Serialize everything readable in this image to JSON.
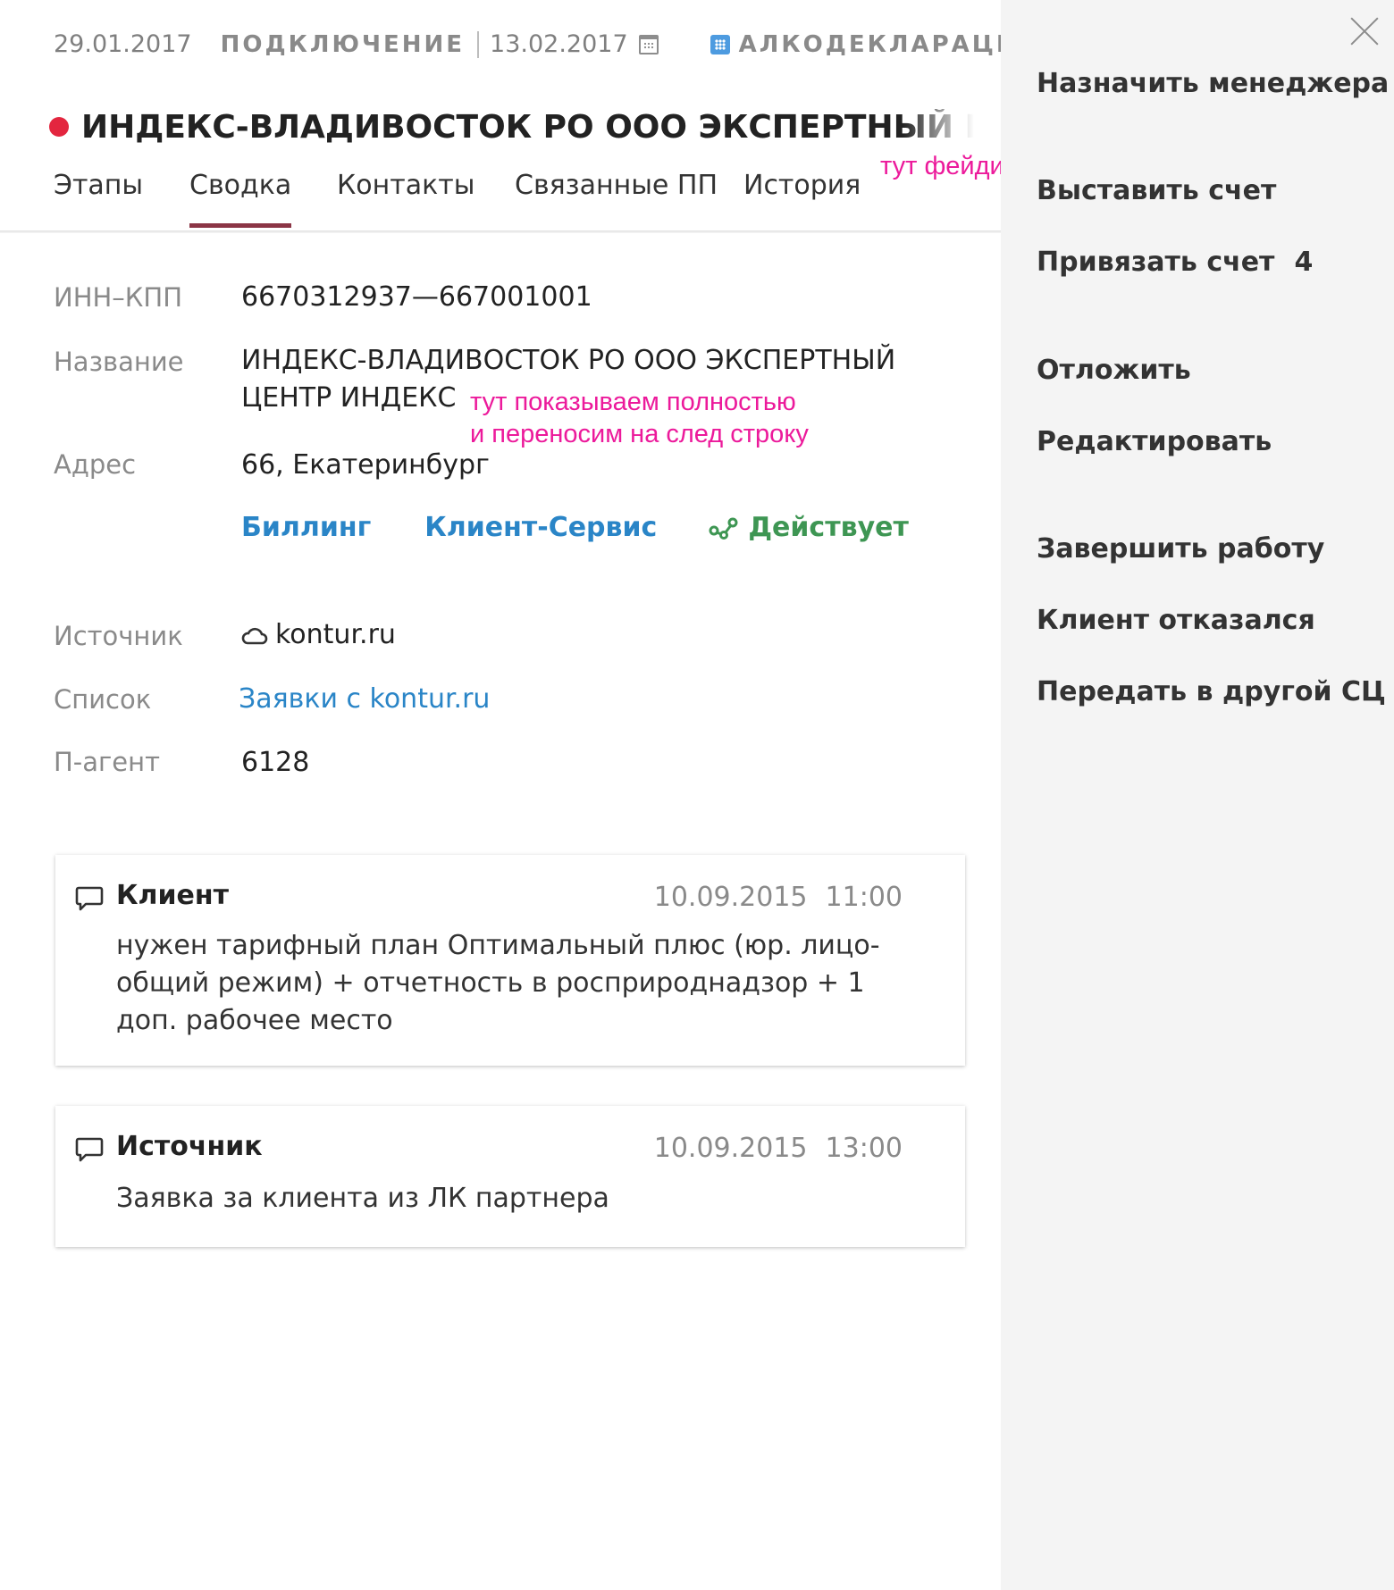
{
  "header": {
    "date_start": "29.01.2017",
    "stage": "ПОДКЛЮЧЕНИЕ",
    "date_due": "13.02.2017",
    "product": "АЛКОДЕКЛАРАЦИЯ",
    "title": "ИНДЕКС-ВЛАДИВОСТОК РО ООО ЭКСПЕРТНЫЙ ЦЕНТР ИНДЕКС",
    "status_color": "#e3263f",
    "fade_note": "тут фейдим"
  },
  "tabs": [
    {
      "label": "Этапы",
      "active": false
    },
    {
      "label": "Сводка",
      "active": true
    },
    {
      "label": "Контакты",
      "active": false
    },
    {
      "label": "Связанные ПП",
      "active": false
    },
    {
      "label": "История",
      "active": false
    }
  ],
  "fields": {
    "inn_label": "ИНН–КПП",
    "inn_value": "6670312937—667001001",
    "name_label": "Название",
    "name_value": "ИНДЕКС-ВЛАДИВОСТОК РО ООО ЭКСПЕРТНЫЙ ЦЕНТР ИНДЕКС",
    "name_note": "тут показываем полностью\nи переносим на след строку",
    "address_label": "Адрес",
    "address_value": "66, Екатеринбург",
    "source_label": "Источник",
    "source_value": "kontur.ru",
    "source_icon": "cloud-icon",
    "list_label": "Список",
    "list_value": "Заявки с kontur.ru",
    "agent_label": "П-агент",
    "agent_value": "6128"
  },
  "links": {
    "billing": "Биллинг",
    "client_service": "Клиент-Сервис",
    "status": "Действует",
    "status_color": "#3e9653",
    "link_color": "#2a85c7"
  },
  "comments": [
    {
      "author": "Клиент",
      "date": "10.09.2015",
      "time": "11:00",
      "text": "нужен тарифный план Оптимальный плюс (юр. лицо-общий режим) + отчетность в росприроднадзор + 1 доп. рабочее место"
    },
    {
      "author": "Источник",
      "date": "10.09.2015",
      "time": "13:00",
      "text": "Заявка за клиента из ЛК партнера"
    }
  ],
  "side_menu": {
    "assign_manager": "Назначить менеджера",
    "issue_invoice": "Выставить счет",
    "link_invoice": "Привязать счет",
    "link_invoice_count": "4",
    "postpone": "Отложить",
    "edit": "Редактировать",
    "finish": "Завершить работу",
    "client_refused": "Клиент отказался",
    "transfer": "Передать в другой СЦ"
  },
  "accent_color": "#8b3545",
  "annotation_color": "#ec1a9b"
}
